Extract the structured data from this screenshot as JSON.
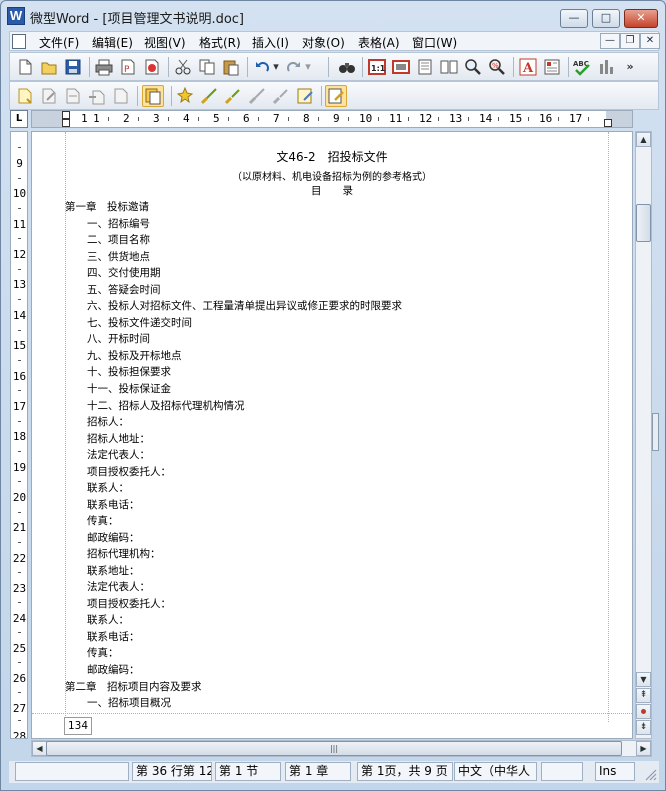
{
  "window": {
    "title": "微型Word - [项目管理文书说明.doc]",
    "app_icon_letter": "W"
  },
  "window_controls": {
    "minimize": "—",
    "maximize": "□",
    "close": "✕"
  },
  "menu": {
    "items": [
      "文件(F)",
      "编辑(E)",
      "视图(V)",
      "格式(R)",
      "插入(I)",
      "对象(O)",
      "表格(A)",
      "窗口(W)"
    ],
    "mdi_controls": [
      "—",
      "❐",
      "✕"
    ]
  },
  "toolbar1": {
    "icons": [
      "new-document-icon",
      "open-folder-icon",
      "save-icon",
      "print-icon",
      "print-preview-icon",
      "cut-icon",
      "copy-icon",
      "paste-icon",
      "undo-icon",
      "undo-dropdown-icon",
      "redo-icon",
      "redo-dropdown-icon",
      "find-icon",
      "zoom-1to1-icon",
      "page-view-icon",
      "normal-view-icon",
      "two-page-view-icon",
      "zoom-icon",
      "zoom-percent-icon",
      "font-color-icon",
      "text-box-icon",
      "spellcheck-icon",
      "word-count-icon",
      "more-icon"
    ]
  },
  "toolbar2": {
    "icons": [
      "track-insert-icon",
      "track-edit-icon",
      "track-comment-icon",
      "track-move-icon",
      "track-delete-icon",
      "track-changes-toggle-icon",
      "accept-change-icon",
      "accept-all-icon",
      "reject-change-icon",
      "reject-all-icon",
      "edit-note-icon",
      "show-markup-icon"
    ]
  },
  "ruler": {
    "corner_label": "L",
    "h_numbers": [
      "1",
      "1",
      "2",
      "3",
      "4",
      "5",
      "6",
      "7",
      "8",
      "9",
      "10",
      "11",
      "12",
      "13",
      "14",
      "15",
      "16",
      "17"
    ],
    "v_numbers": [
      "9",
      "10",
      "11",
      "12",
      "13",
      "14",
      "15",
      "16",
      "17",
      "18",
      "19",
      "20",
      "21",
      "22",
      "23",
      "24",
      "25",
      "26",
      "27",
      "28"
    ]
  },
  "document": {
    "title": "文46-2　招投标文件",
    "subtitle": "（以原材料、机电设备招标为例的参考格式）",
    "toc_heading": "目　　录",
    "lines": [
      {
        "text": "第一章　投标邀请",
        "indent": 0
      },
      {
        "text": "一、招标编号",
        "indent": 1
      },
      {
        "text": "二、项目名称",
        "indent": 1
      },
      {
        "text": "三、供货地点",
        "indent": 1
      },
      {
        "text": "四、交付使用期",
        "indent": 1
      },
      {
        "text": "五、答疑会时间",
        "indent": 1
      },
      {
        "text": "六、投标人对招标文件、工程量清单提出异议或修正要求的时限要求",
        "indent": 1
      },
      {
        "text": "七、投标文件递交时间",
        "indent": 1
      },
      {
        "text": "八、开标时间",
        "indent": 1
      },
      {
        "text": "九、投标及开标地点",
        "indent": 1
      },
      {
        "text": "十、投标担保要求",
        "indent": 1
      },
      {
        "text": "十一、投标保证金",
        "indent": 1
      },
      {
        "text": "十二、招标人及招标代理机构情况",
        "indent": 1
      },
      {
        "text": "招标人：",
        "indent": 1
      },
      {
        "text": "招标人地址：",
        "indent": 1
      },
      {
        "text": "法定代表人：",
        "indent": 1
      },
      {
        "text": "项目授权委托人：",
        "indent": 1
      },
      {
        "text": "联系人：",
        "indent": 1
      },
      {
        "text": "联系电话：",
        "indent": 1
      },
      {
        "text": "传真：",
        "indent": 1
      },
      {
        "text": "邮政编码：",
        "indent": 1
      },
      {
        "text": "招标代理机构：",
        "indent": 1
      },
      {
        "text": "联系地址：",
        "indent": 1
      },
      {
        "text": "法定代表人：",
        "indent": 1
      },
      {
        "text": "项目授权委托人：",
        "indent": 1
      },
      {
        "text": "联系人：",
        "indent": 1
      },
      {
        "text": "联系电话：",
        "indent": 1
      },
      {
        "text": "传真：",
        "indent": 1
      },
      {
        "text": "邮政编码：",
        "indent": 1
      },
      {
        "text": "第二章　招标项目内容及要求",
        "indent": 0
      },
      {
        "text": "一、招标项目概况",
        "indent": 1
      }
    ],
    "page_number": "134"
  },
  "status": {
    "cells": [
      "",
      "第 36 行第 12",
      "第 1 节",
      "第 1 章",
      "第 1页，共 9 页",
      "中文（中华人",
      "",
      "Ins"
    ]
  }
}
